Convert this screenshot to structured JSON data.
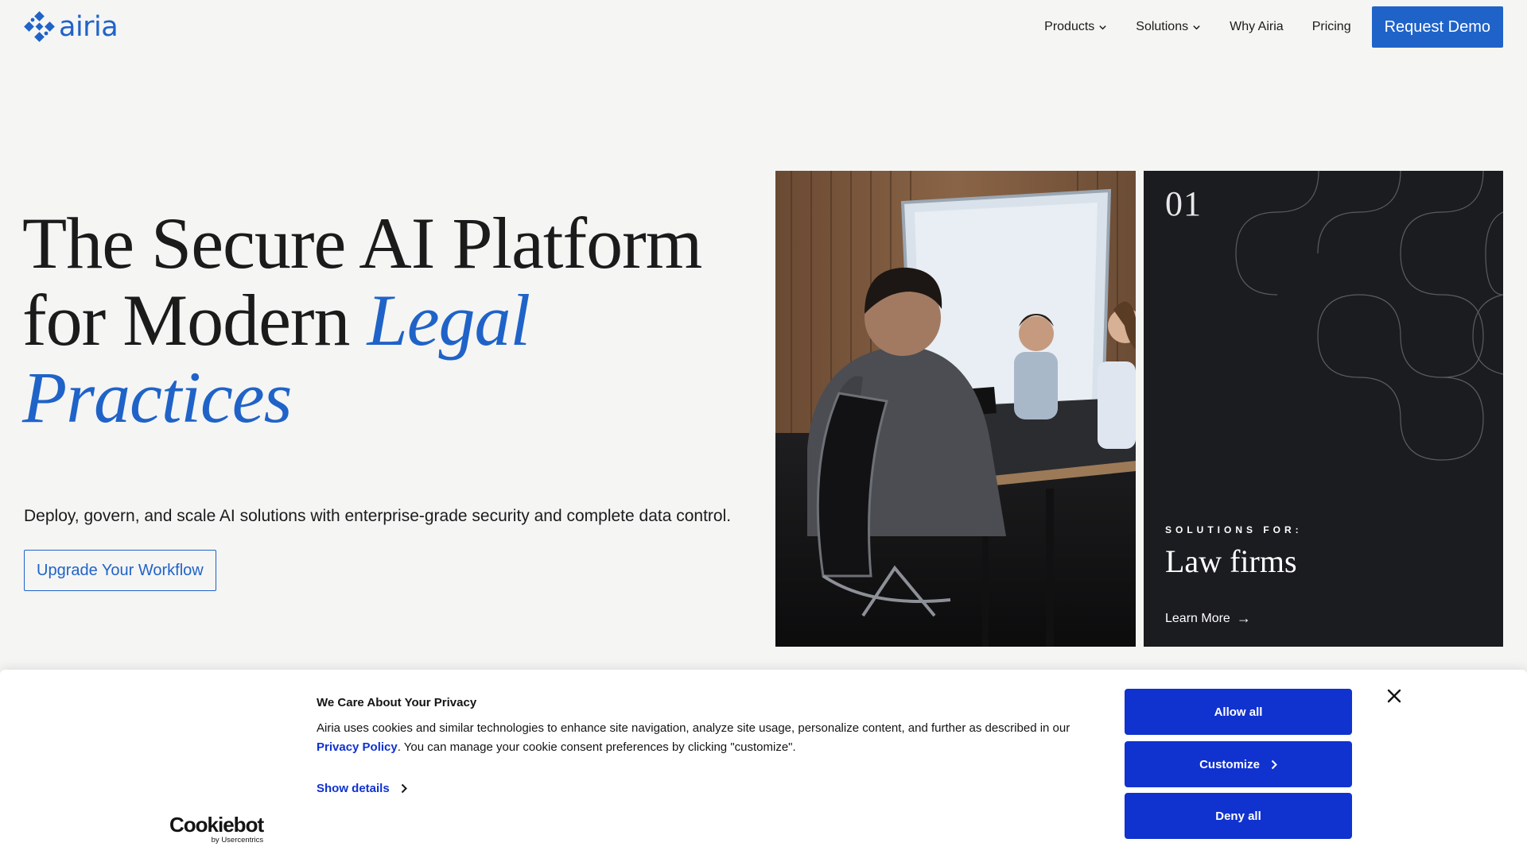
{
  "header": {
    "logo_text": "airia",
    "nav": {
      "products": "Products",
      "solutions": "Solutions",
      "why": "Why Airia",
      "pricing": "Pricing"
    },
    "cta": "Request Demo"
  },
  "hero": {
    "title_line1": "The Secure AI Platform",
    "title_line2_plain": "for Modern ",
    "title_line2_accent": "Legal",
    "title_line3_accent": "Practices",
    "subtitle": "Deploy, govern, and scale AI solutions with enterprise-grade security and complete data control.",
    "cta": "Upgrade Your Workflow"
  },
  "solution_card": {
    "number": "01",
    "eyebrow": "SOLUTIONS FOR:",
    "title": "Law firms",
    "link": "Learn More",
    "link_arrow": "→"
  },
  "cookie_banner": {
    "title": "We Care About Your Privacy",
    "text_before": "Airia uses cookies and similar technologies to enhance site navigation, analyze site usage, personalize content, and further as described in our ",
    "privacy_link": "Privacy Policy",
    "text_after": ". You can manage your cookie consent preferences by clicking \"customize\".",
    "show_details": "Show details",
    "allow_all": "Allow all",
    "customize": "Customize",
    "deny_all": "Deny all",
    "brand": "Cookiebot",
    "brand_sub": "by Usercentrics"
  },
  "colors": {
    "accent": "#1f63c8",
    "cookie_button": "#1032cf",
    "page_background": "#f5f5f4",
    "dark_card": "#1b1c20"
  }
}
